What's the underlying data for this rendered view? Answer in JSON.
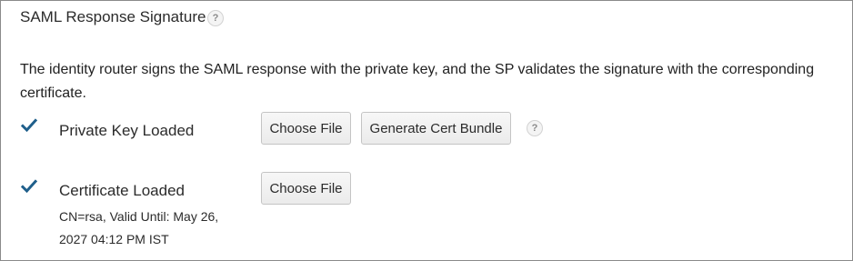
{
  "section": {
    "title": "SAML Response Signature",
    "help_glyph": "?"
  },
  "description": "The identity router signs the SAML response with the private key, and the SP validates the signature with the corresponding certificate.",
  "rows": [
    {
      "status_icon": "checkmark-icon",
      "label": "Private Key Loaded",
      "buttons": {
        "choose_file": "Choose File",
        "generate_cert_bundle": "Generate Cert Bundle"
      },
      "help_glyph": "?"
    },
    {
      "status_icon": "checkmark-icon",
      "label": "Certificate Loaded",
      "detail": "CN=rsa, Valid Until: May 26, 2027 04:12 PM IST",
      "buttons": {
        "choose_file": "Choose File"
      }
    }
  ],
  "colors": {
    "check": "#1f5f8b",
    "border": "#8a8a8a",
    "button_bg": "#efefef"
  }
}
